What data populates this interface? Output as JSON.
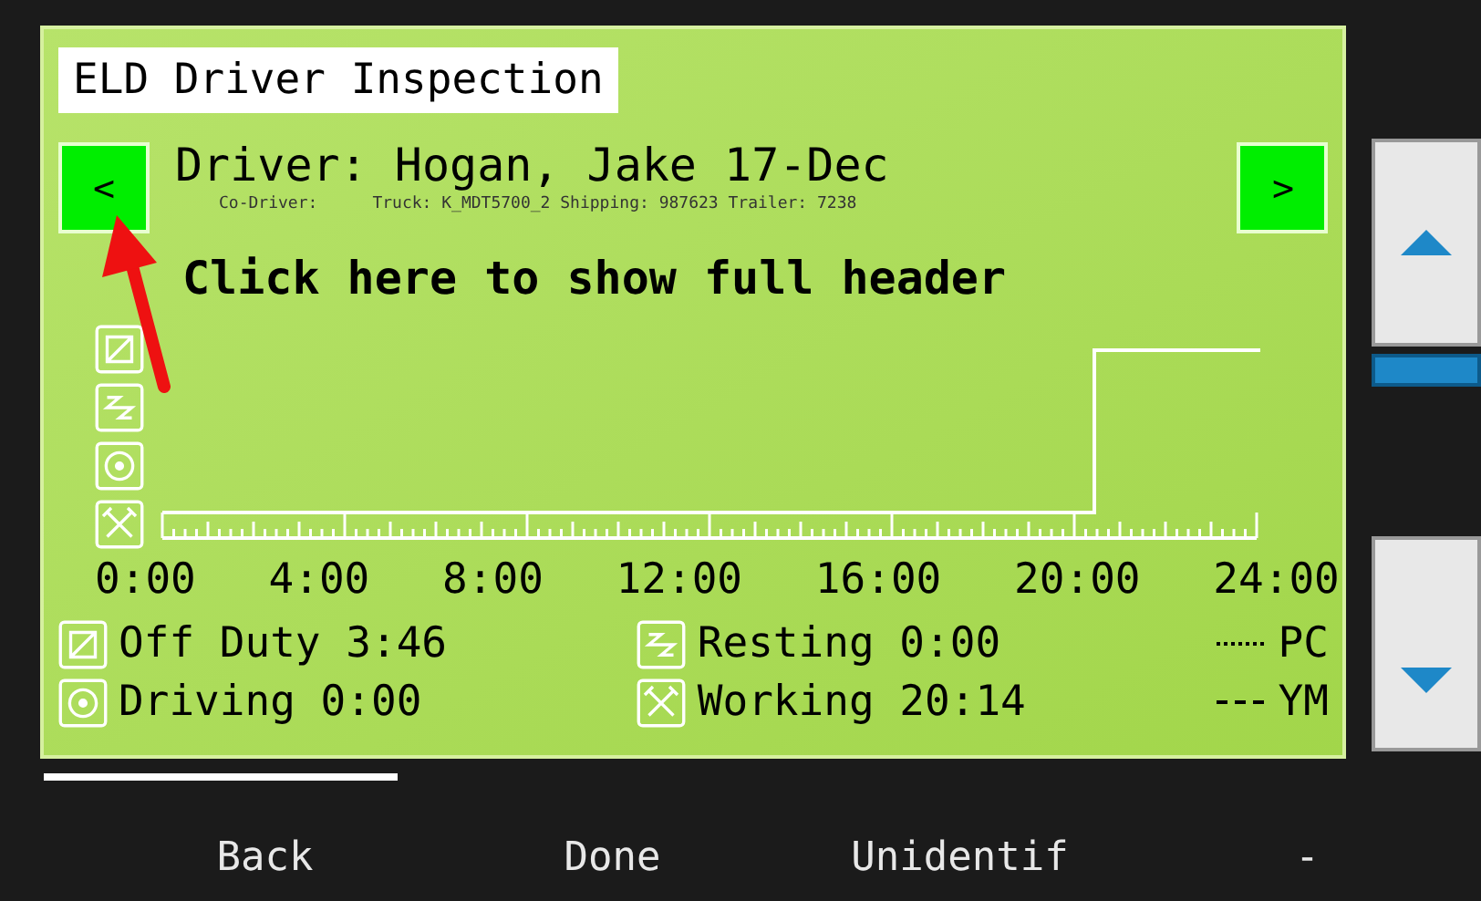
{
  "title": "ELD Driver Inspection",
  "nav": {
    "prev": "<",
    "next": ">"
  },
  "driver_line": "Driver: Hogan, Jake 17-Dec",
  "details": [
    "Co-Driver:",
    "Truck: K_MDT5700_2 Shipping: 987623 Trailer: 7238"
  ],
  "header_link": "Click here to show full header",
  "axis_labels": [
    "0:00",
    "4:00",
    "8:00",
    "12:00",
    "16:00",
    "20:00",
    "24:00"
  ],
  "legend": [
    {
      "kind": "off",
      "text": "Off Duty 3:46"
    },
    {
      "kind": "sleep",
      "text": "Resting 0:00"
    },
    {
      "kind": "drive",
      "text": "Driving 0:00"
    },
    {
      "kind": "work",
      "text": "Working 20:14"
    }
  ],
  "line_keys": [
    {
      "kind": "dotted",
      "text": "PC"
    },
    {
      "kind": "dashed",
      "text": "YM"
    }
  ],
  "softkeys": [
    "Back",
    "Done",
    "Unidentif",
    "-"
  ]
}
